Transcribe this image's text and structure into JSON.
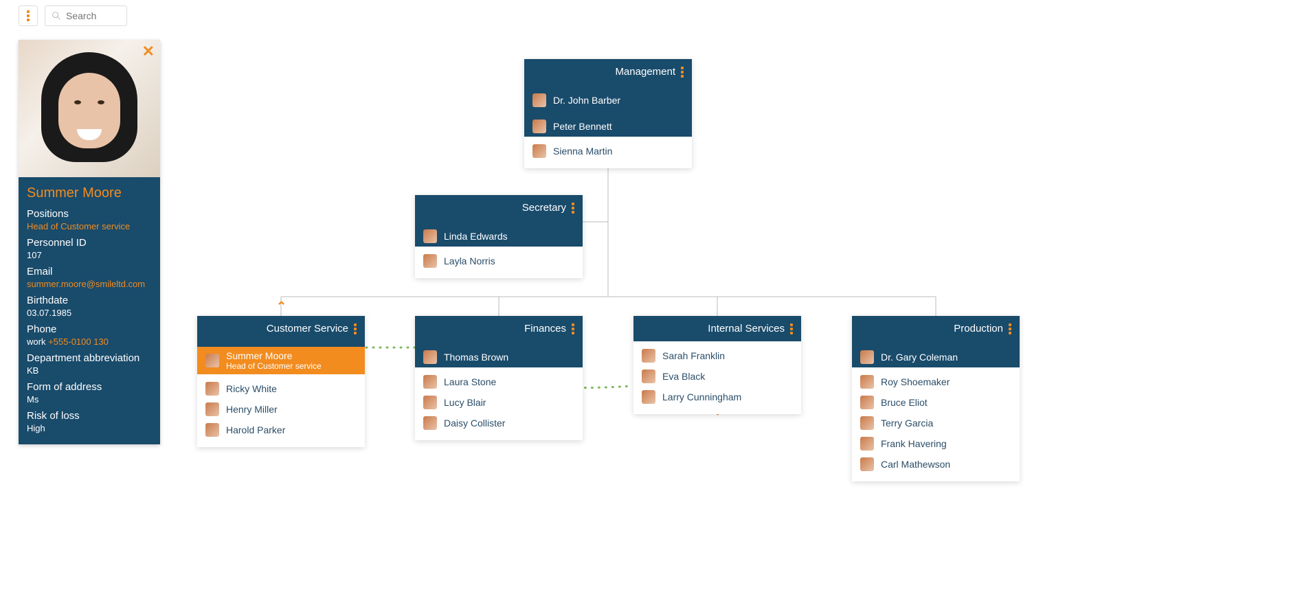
{
  "search": {
    "placeholder": "Search"
  },
  "details": {
    "name": "Summer Moore",
    "positions_label": "Positions",
    "positions_value": "Head of Customer service",
    "personnel_id_label": "Personnel ID",
    "personnel_id_value": "107",
    "email_label": "Email",
    "email_value": "summer.moore@smileltd.com",
    "birthdate_label": "Birthdate",
    "birthdate_value": "03.07.1985",
    "phone_label": "Phone",
    "phone_type": "work",
    "phone_value": "+555-0100 130",
    "dept_abbrev_label": "Department abbreviation",
    "dept_abbrev_value": "KB",
    "form_address_label": "Form of address",
    "form_address_value": "Ms",
    "risk_label": "Risk of loss",
    "risk_value": "High"
  },
  "nodes": {
    "management": {
      "title": "Management",
      "leaders": [
        "Dr. John Barber",
        "Peter Bennett"
      ],
      "assistants": [
        "Sienna Martin"
      ]
    },
    "secretary": {
      "title": "Secretary",
      "leaders": [
        "Linda Edwards"
      ],
      "assistants": [
        "Layla Norris"
      ]
    },
    "customer_service": {
      "title": "Customer Service",
      "highlighted": {
        "name": "Summer Moore",
        "subtitle": "Head of Customer service"
      },
      "people": [
        "Ricky White",
        "Henry Miller",
        "Harold Parker"
      ]
    },
    "finances": {
      "title": "Finances",
      "leaders": [
        "Thomas Brown"
      ],
      "people": [
        "Laura Stone",
        "Lucy Blair",
        "Daisy Collister"
      ]
    },
    "internal_services": {
      "title": "Internal Services",
      "people": [
        "Sarah Franklin",
        "Eva Black",
        "Larry Cunningham"
      ]
    },
    "production": {
      "title": "Production",
      "leaders": [
        "Dr. Gary Coleman"
      ],
      "people": [
        "Roy Shoemaker",
        "Bruce Eliot",
        "Terry Garcia",
        "Frank Havering",
        "Carl Mathewson"
      ]
    }
  }
}
